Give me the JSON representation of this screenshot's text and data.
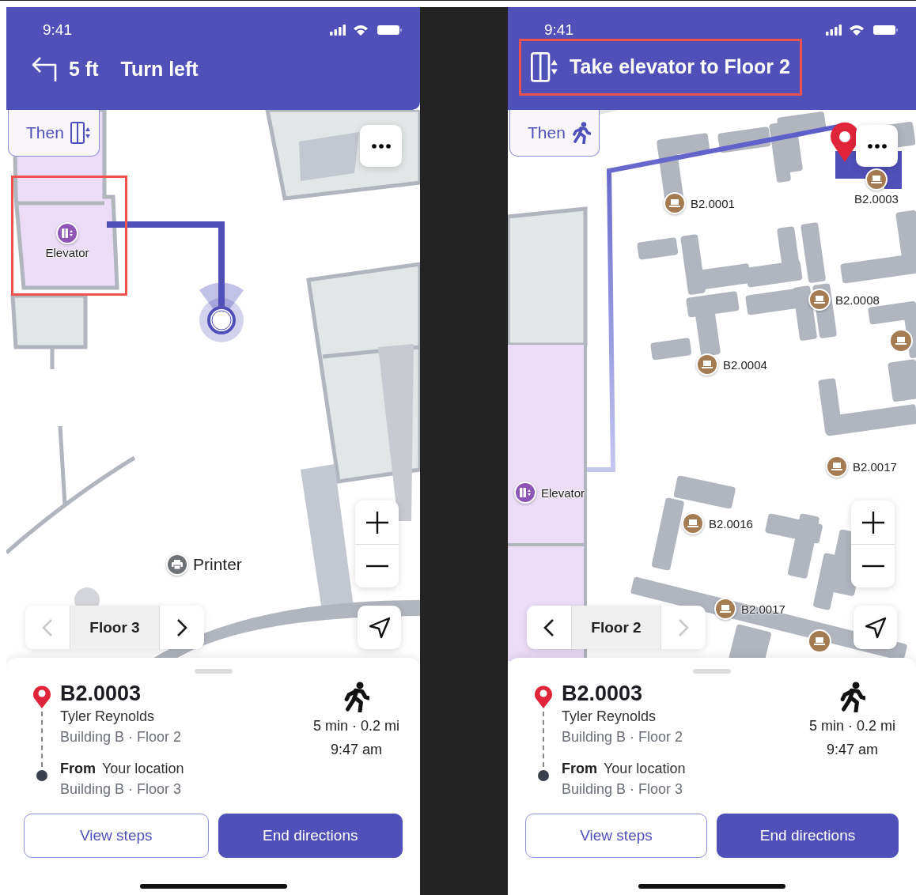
{
  "screens": [
    {
      "status_bar": {
        "time": "9:41"
      },
      "instruction": {
        "kind": "turn-left",
        "distance": "5 ft",
        "text": "Turn left",
        "highlighted": false
      },
      "then": {
        "label": "Then",
        "kind": "elevator"
      },
      "map": {
        "pois": [
          {
            "label": "Elevator",
            "kind": "elevator",
            "highlighted": true
          },
          {
            "label": "Printer",
            "kind": "printer",
            "highlighted": false
          }
        ]
      },
      "floor": {
        "label": "Floor 3",
        "prev_disabled": true,
        "next_disabled": false
      },
      "destination": {
        "name": "B2.0003",
        "person": "Tyler Reynolds",
        "place": "Building B · Floor 2"
      },
      "origin": {
        "label": "From",
        "name": "Your location",
        "place": "Building B · Floor 3"
      },
      "trip": {
        "duration": "5 min · 0.2 mi",
        "arrival": "9:47 am"
      },
      "buttons": [
        {
          "label": "View steps",
          "kind": "secondary"
        },
        {
          "label": "End directions",
          "kind": "primary"
        }
      ]
    },
    {
      "status_bar": {
        "time": "9:41"
      },
      "instruction": {
        "kind": "elevator",
        "text": "Take elevator to Floor 2",
        "highlighted": true
      },
      "then": {
        "label": "Then",
        "kind": "walk"
      },
      "map": {
        "pois": [
          {
            "label": "B2.0003",
            "kind": "desk",
            "highlighted": false
          },
          {
            "label": "B2.0001",
            "kind": "desk",
            "highlighted": false
          },
          {
            "label": "B2.0008",
            "kind": "desk",
            "highlighted": false
          },
          {
            "label": "B2.0004",
            "kind": "desk",
            "highlighted": false
          },
          {
            "label": "B2.0017",
            "kind": "desk",
            "highlighted": false
          },
          {
            "label": "Elevator",
            "kind": "elevator",
            "highlighted": false
          },
          {
            "label": "B2.0016",
            "kind": "desk",
            "highlighted": false
          },
          {
            "label": "B2.0017",
            "kind": "desk",
            "highlighted": false
          }
        ]
      },
      "floor": {
        "label": "Floor 2",
        "prev_disabled": false,
        "next_disabled": true
      },
      "destination": {
        "name": "B2.0003",
        "person": "Tyler Reynolds",
        "place": "Building B · Floor 2"
      },
      "origin": {
        "label": "From",
        "name": "Your location",
        "place": "Building B · Floor 3"
      },
      "trip": {
        "duration": "5 min · 0.2 mi",
        "arrival": "9:47 am"
      },
      "buttons": [
        {
          "label": "View steps",
          "kind": "secondary"
        },
        {
          "label": "End directions",
          "kind": "primary"
        }
      ]
    }
  ]
}
